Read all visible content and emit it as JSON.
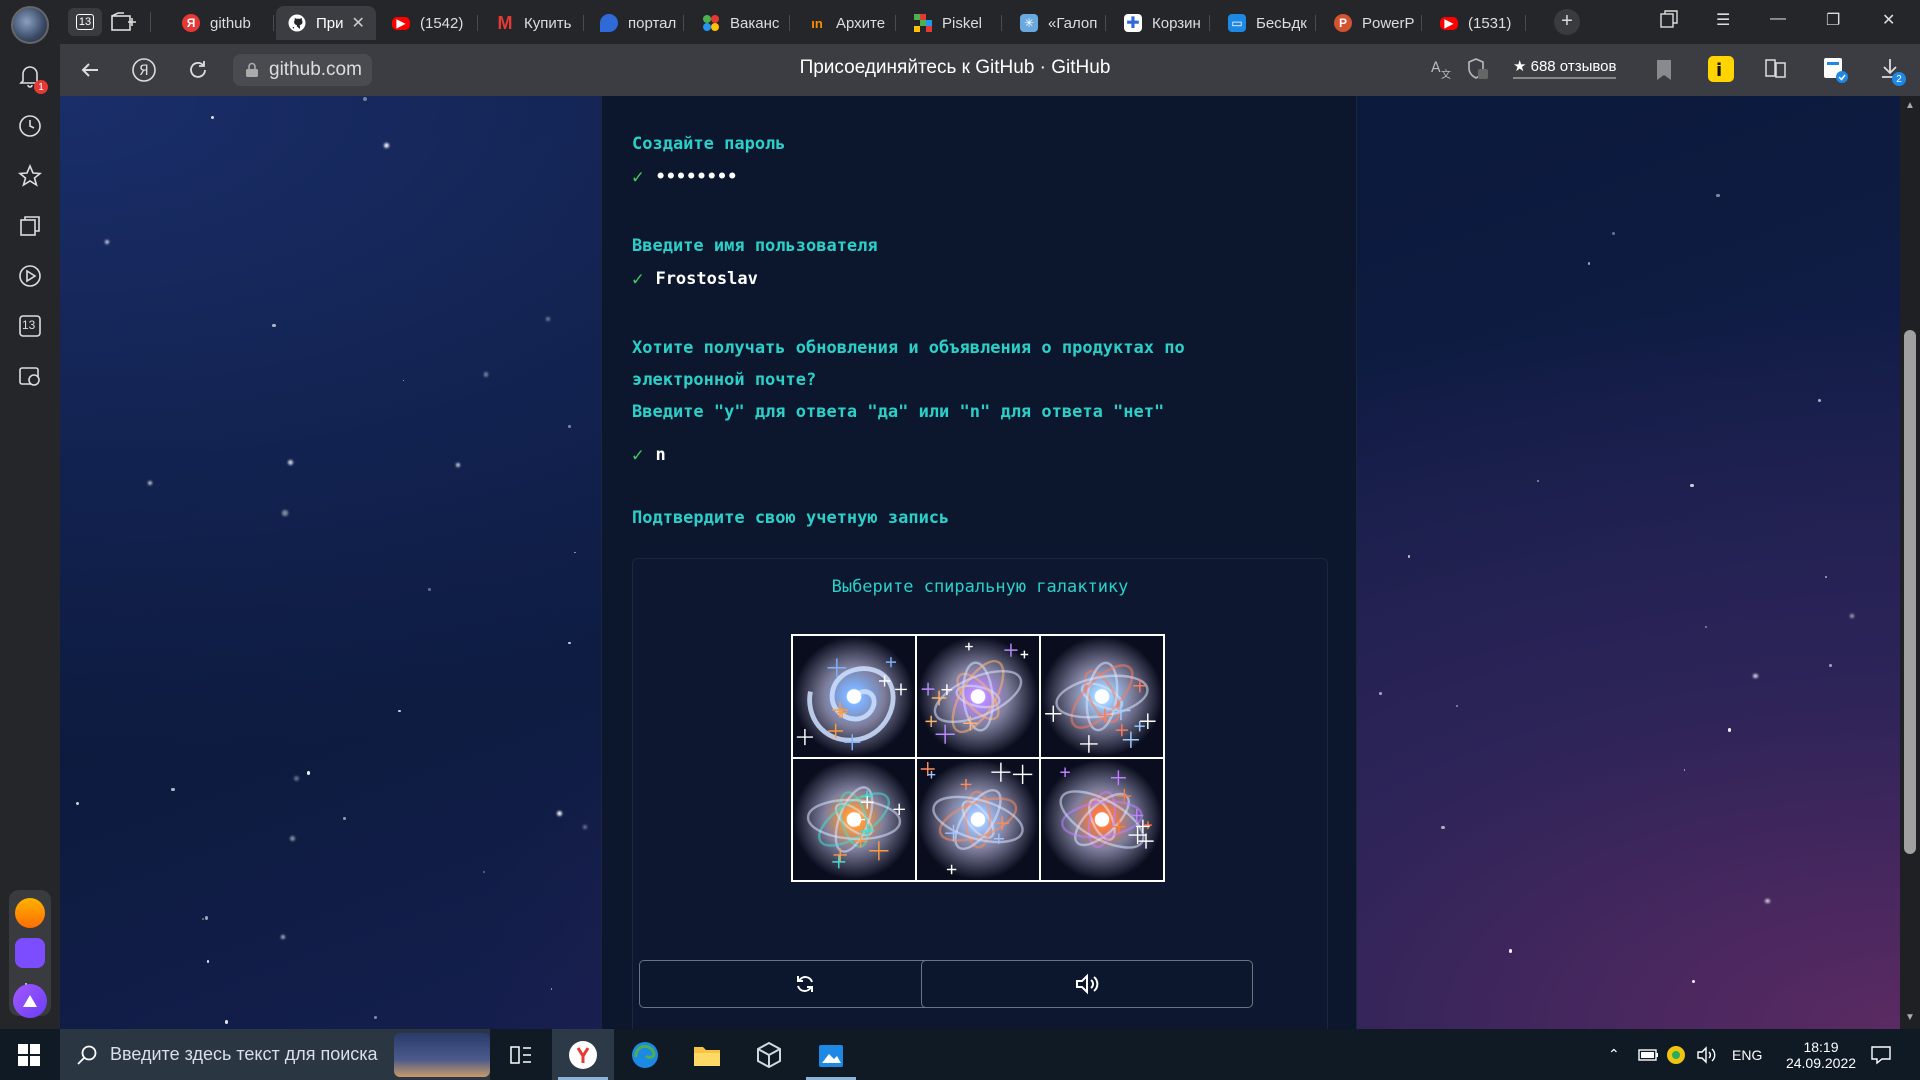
{
  "browser": {
    "tab_count": "13",
    "tabs": [
      {
        "label": "github",
        "icon": "yandex",
        "color": "#e53935"
      },
      {
        "label": "При",
        "icon": "github",
        "color": "#ffffff"
      },
      {
        "label": "(1542)",
        "icon": "youtube",
        "color": "#ff0000"
      },
      {
        "label": "Купить",
        "icon": "m",
        "color": "#e53935"
      },
      {
        "label": "портал",
        "icon": "portal",
        "color": "#2f6bd8"
      },
      {
        "label": "Ваканс",
        "icon": "dots",
        "color": "#4caf50"
      },
      {
        "label": "Архите",
        "icon": "hh",
        "color": "#ff8a00"
      },
      {
        "label": "Piskel",
        "icon": "piskel",
        "color": "#4caf50"
      },
      {
        "label": "«Галоп",
        "icon": "star",
        "color": "#5aa0e0"
      },
      {
        "label": "Корзин",
        "icon": "cross",
        "color": "#2f6bd8"
      },
      {
        "label": "БесЬдк",
        "icon": "chat",
        "color": "#1e88e5"
      },
      {
        "label": "PowerP",
        "icon": "ppt",
        "color": "#d35230"
      },
      {
        "label": "(1531)",
        "icon": "youtube",
        "color": "#ff0000"
      }
    ],
    "url": "github.com",
    "page_title": "Присоединяйтесь к GitHub · GitHub",
    "reviews": "★ 688 отзывов",
    "notification_badge": "1",
    "downloads_badge": "2",
    "tabs_badge": "13"
  },
  "signup": {
    "password_prompt": "Создайте пароль",
    "password_value": "••••••••",
    "username_prompt": "Введите имя пользователя",
    "username_value": "Frostoslav",
    "updates_prompt_line1": "Хотите получать обновления и объявления о продуктах по",
    "updates_prompt_line2": "электронной почте?",
    "updates_prompt_line3": "Введите \"y\" для ответа \"да\" или \"n\" для ответа \"нет\"",
    "updates_value": "n",
    "verify_prompt": "Подтвердите свою учетную запись",
    "check_mark": "✓"
  },
  "captcha": {
    "title": "Выберите спиральную галактику",
    "images": [
      "galaxy-1",
      "galaxy-2",
      "galaxy-3",
      "galaxy-4",
      "galaxy-5",
      "galaxy-6"
    ]
  },
  "taskbar": {
    "search_placeholder": "Введите здесь текст для поиска",
    "lang": "ENG",
    "time": "18:19",
    "date": "24.09.2022"
  },
  "colors": {
    "accent": "#2bd0c8",
    "check": "#3fcf5f",
    "panel": "#0c162d"
  }
}
